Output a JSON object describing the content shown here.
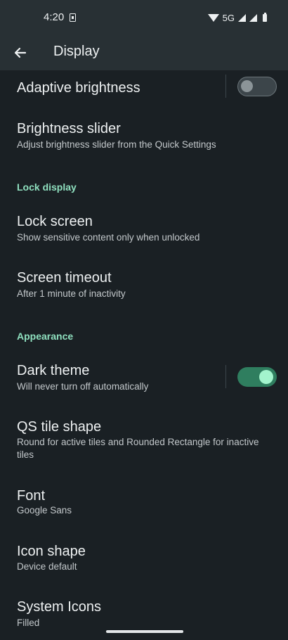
{
  "status": {
    "time": "4:20",
    "network": "5G"
  },
  "appbar": {
    "title": "Display",
    "back_icon": "arrow-back-icon"
  },
  "settings": {
    "adaptive_brightness": {
      "title": "Adaptive brightness",
      "enabled": false
    },
    "brightness_slider": {
      "title": "Brightness slider",
      "subtitle": "Adjust brightness slider from the Quick Settings"
    },
    "lock_display_header": "Lock display",
    "lock_screen": {
      "title": "Lock screen",
      "subtitle": "Show sensitive content only when unlocked"
    },
    "screen_timeout": {
      "title": "Screen timeout",
      "subtitle": "After 1 minute of inactivity"
    },
    "appearance_header": "Appearance",
    "dark_theme": {
      "title": "Dark theme",
      "subtitle": "Will never turn off automatically",
      "enabled": true
    },
    "qs_tile_shape": {
      "title": "QS tile shape",
      "subtitle": "Round for active tiles and Rounded Rectangle for inactive tiles"
    },
    "font": {
      "title": "Font",
      "subtitle": "Google Sans"
    },
    "icon_shape": {
      "title": "Icon shape",
      "subtitle": "Device default"
    },
    "system_icons": {
      "title": "System Icons",
      "subtitle": "Filled"
    }
  },
  "colors": {
    "background": "#1a2024",
    "appbar": "#283034",
    "accent": "#8fe0bf",
    "toggle_on": "#2f7e5f"
  }
}
